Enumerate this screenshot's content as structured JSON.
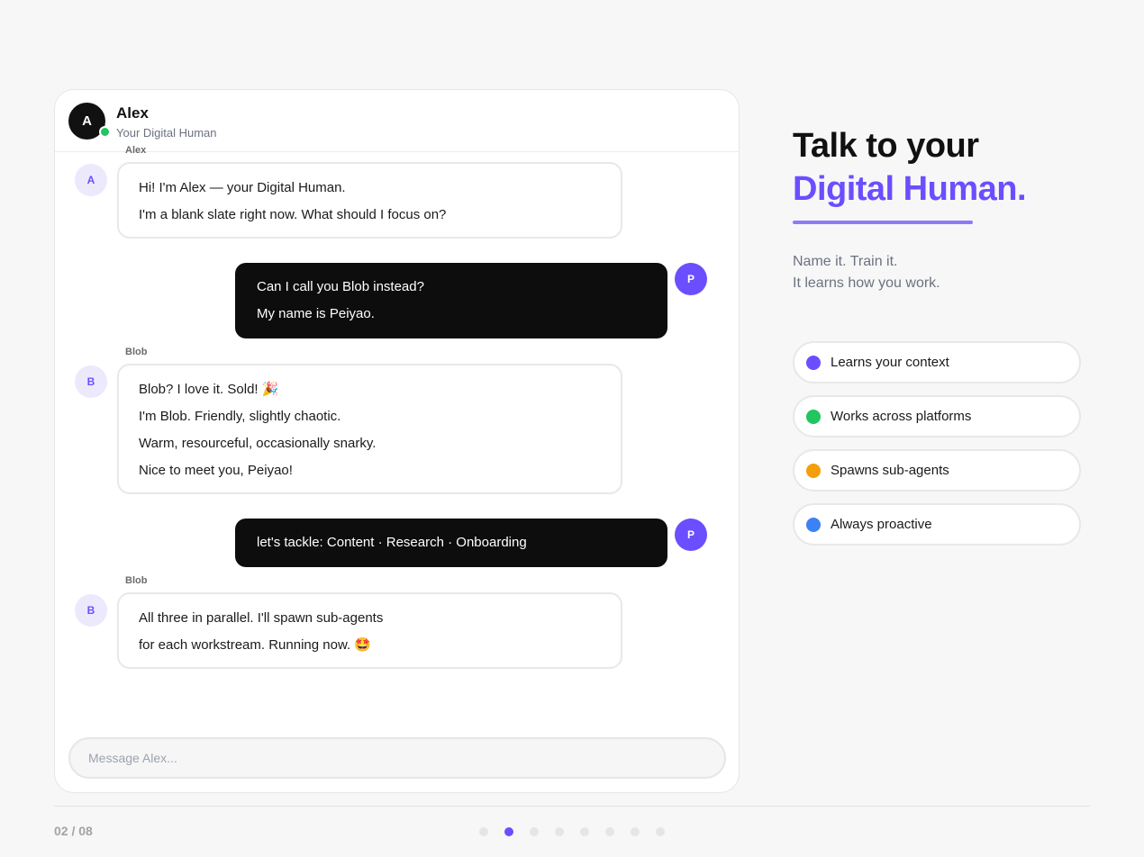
{
  "chat": {
    "header": {
      "avatar_initial": "A",
      "name": "Alex",
      "subtitle": "Your Digital Human"
    },
    "messages": [
      {
        "role": "bot",
        "sender": "Alex",
        "initial": "A",
        "lines": [
          "Hi! I'm Alex — your Digital Human.",
          "I'm a blank slate right now. What should I focus on?"
        ]
      },
      {
        "role": "user",
        "initial": "P",
        "lines": [
          "Can I call you Blob instead?",
          "My name is Peiyao."
        ]
      },
      {
        "role": "bot",
        "sender": "Blob",
        "initial": "B",
        "lines": [
          "Blob? I love it. Sold! 🎉",
          "I'm Blob. Friendly, slightly chaotic.",
          "Warm, resourceful, occasionally snarky.",
          "Nice to meet you, Peiyao!"
        ]
      },
      {
        "role": "user",
        "initial": "P",
        "lines": [
          "let's tackle: Content · Research · Onboarding"
        ]
      },
      {
        "role": "bot",
        "sender": "Blob",
        "initial": "B",
        "lines": [
          "All three in parallel. I'll spawn sub-agents",
          "for each workstream. Running now. 🤩"
        ]
      }
    ],
    "input": {
      "placeholder": "Message Alex...",
      "value": ""
    }
  },
  "hero": {
    "line1": "Talk to your",
    "line2": "Digital Human.",
    "tagline": [
      "Name it. Train it.",
      "It learns how you work."
    ]
  },
  "features": [
    {
      "label": "Learns your context",
      "color": "#6b4eff"
    },
    {
      "label": "Works across platforms",
      "color": "#22c55e"
    },
    {
      "label": "Spawns sub-agents",
      "color": "#f59e0b"
    },
    {
      "label": "Always proactive",
      "color": "#3b82f6"
    }
  ],
  "footer": {
    "page_indicator": "02 / 08",
    "total_dots": 8,
    "active_dot": 1
  },
  "colors": {
    "accent": "#6b4eff",
    "online": "#22c55e",
    "user_bubble": "#0d0d0d"
  }
}
